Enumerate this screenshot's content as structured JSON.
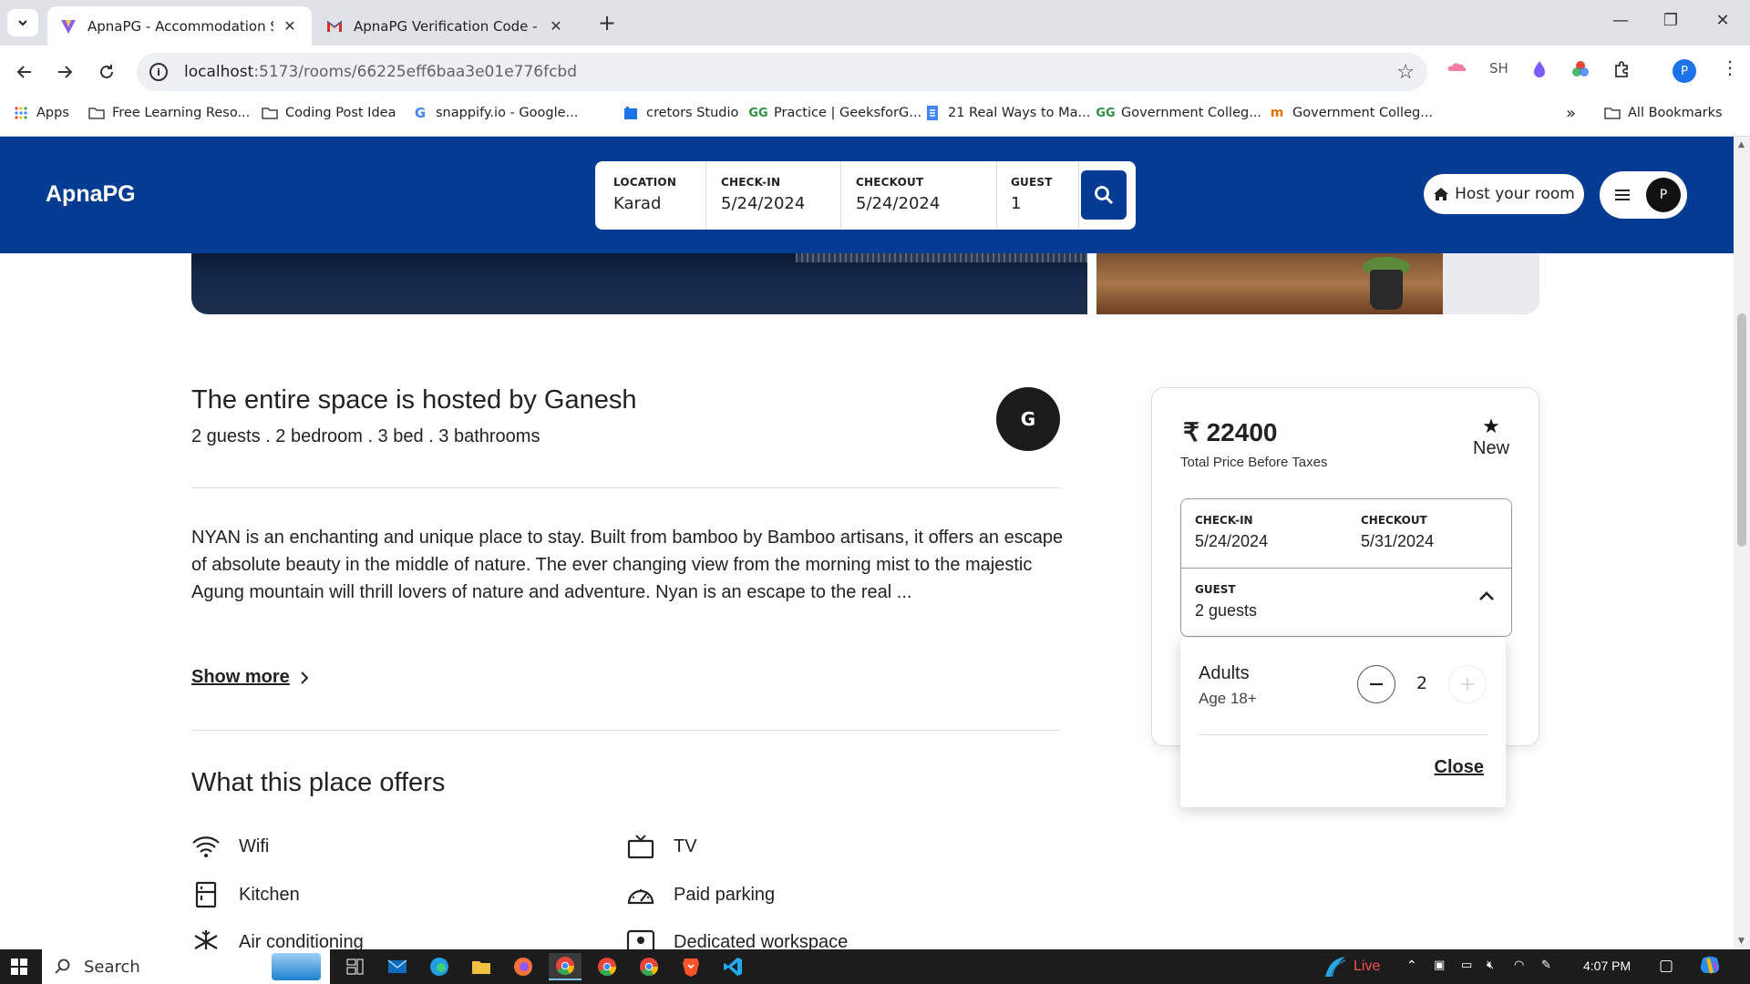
{
  "browser": {
    "tabs": [
      {
        "title": "ApnaPG - Accommodation Solu",
        "active": true
      },
      {
        "title": "ApnaPG Verification Code - pra",
        "active": false
      }
    ],
    "url_host": "localhost",
    "url_path": ":5173/rooms/66225eff6baa3e01e776fcbd",
    "bookmarks": [
      {
        "label": "Apps",
        "icon": "apps-grid-icon"
      },
      {
        "label": "Free Learning Reso...",
        "icon": "folder-icon"
      },
      {
        "label": "Coding Post Idea",
        "icon": "folder-icon"
      },
      {
        "label": "snappify.io - Google...",
        "icon": "google-icon"
      },
      {
        "label": "cretors Studio",
        "icon": "studio-icon"
      },
      {
        "label": "Practice | GeeksforG...",
        "icon": "gfg-icon"
      },
      {
        "label": "21 Real Ways to Ma...",
        "icon": "doc-icon"
      },
      {
        "label": "Government Colleg...",
        "icon": "gfg-icon"
      },
      {
        "label": "Government Colleg...",
        "icon": "college-icon"
      },
      {
        "label": "All Bookmarks",
        "icon": "folder-icon"
      }
    ],
    "extensions": {
      "sh": "SH"
    },
    "profile_initial": "P"
  },
  "navbar": {
    "brand": "ApnaPG",
    "search": {
      "location_label": "LOCATION",
      "location_value": "Karad",
      "checkin_label": "CHECK-IN",
      "checkin_value": "5/24/2024",
      "checkout_label": "CHECKOUT",
      "checkout_value": "5/24/2024",
      "guest_label": "GUEST",
      "guest_value": "1"
    },
    "host_button": "Host your room",
    "avatar_initial": "P"
  },
  "listing": {
    "host_title": "The entire space is hosted by Ganesh",
    "host_summary": "2 guests . 2 bedroom . 3 bed . 3 bathrooms",
    "host_initial": "G",
    "description": "NYAN is an enchanting and unique place to stay. Built from bamboo by Bamboo artisans, it offers an escape of absolute beauty in the middle of nature. The ever changing view from the morning mist to the majestic Agung mountain will thrill lovers of nature and adventure. Nyan is an escape to the real ...",
    "show_more": "Show more",
    "offers_title": "What this place offers",
    "amenities": [
      {
        "label": "Wifi",
        "icon": "wifi-icon"
      },
      {
        "label": "TV",
        "icon": "tv-icon"
      },
      {
        "label": "Kitchen",
        "icon": "kitchen-icon"
      },
      {
        "label": "Paid parking",
        "icon": "gauge-icon"
      },
      {
        "label": "Air conditioning",
        "icon": "snowflake-icon"
      },
      {
        "label": "Dedicated workspace",
        "icon": "workspace-icon"
      }
    ]
  },
  "booking": {
    "currency": "₹",
    "price": "22400",
    "price_note": "Total Price Before Taxes",
    "rating_label": "New",
    "checkin_label": "CHECK-IN",
    "checkin_value": "5/24/2024",
    "checkout_label": "CHECKOUT",
    "checkout_value": "5/31/2024",
    "guest_label": "GUEST",
    "guest_value": "2 guests",
    "popup": {
      "adults_label": "Adults",
      "adults_sub": "Age 18+",
      "adults_count": "2",
      "close": "Close"
    }
  },
  "taskbar": {
    "search_placeholder": "Search",
    "live_label": "Live",
    "time": "4:07 PM"
  }
}
